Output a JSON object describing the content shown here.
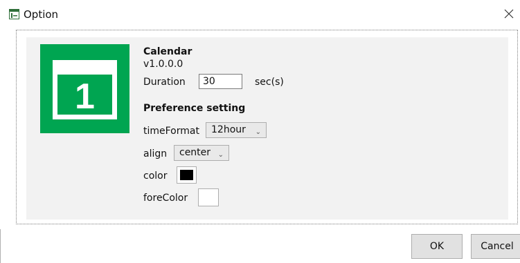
{
  "window": {
    "title": "Option",
    "icon": "app-window-icon",
    "close_icon": "close-icon"
  },
  "plugin": {
    "name": "Calendar",
    "version": "v1.0.0.0",
    "icon": "calendar-icon",
    "icon_number": "1",
    "icon_color": "#00a551"
  },
  "duration": {
    "label": "Duration",
    "value": "30",
    "unit": "sec(s)"
  },
  "preferences": {
    "heading": "Preference setting",
    "time_format": {
      "label": "timeFormat",
      "value": "12hour"
    },
    "align": {
      "label": "align",
      "value": "center"
    },
    "color": {
      "label": "color",
      "value": "#000000"
    },
    "fore_color": {
      "label": "foreColor",
      "value": "#ffffff"
    }
  },
  "buttons": {
    "ok": "OK",
    "cancel": "Cancel"
  }
}
